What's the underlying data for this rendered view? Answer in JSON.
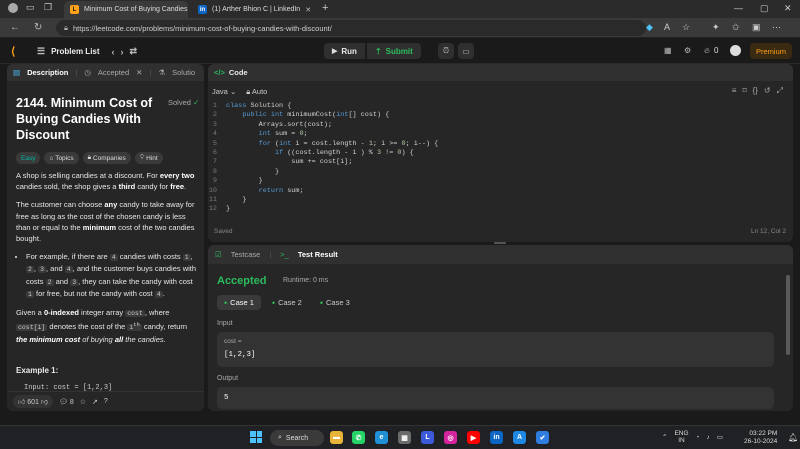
{
  "browser": {
    "tabs": [
      {
        "title": "Minimum Cost of Buying Candies",
        "icon": "leetcode-icon"
      },
      {
        "title": "(1) Arther Bhion C | LinkedIn",
        "icon": "linkedin-icon"
      }
    ],
    "url": "https://leetcode.com/problems/minimum-cost-of-buying-candies-with-discount/"
  },
  "header": {
    "problem_list": "Problem List",
    "run": "Run",
    "submit": "Submit",
    "streak": "0",
    "premium": "Premium"
  },
  "left": {
    "tabs": [
      "Description",
      "Accepted",
      "Solutio"
    ],
    "title": "2144. Minimum Cost of Buying Candies With Discount",
    "solved": "Solved",
    "chips": [
      "Easy",
      "Topics",
      "Companies",
      "Hint"
    ],
    "example_heading": "Example 1:",
    "example_line": "Input: cost = [1,2,3]",
    "likes": "601",
    "comments": "8"
  },
  "code": {
    "tab": "Code",
    "language": "Java",
    "mode": "Auto",
    "lines": [
      "class Solution {",
      "    public int minimumCost(int[] cost) {",
      "        Arrays.sort(cost);",
      "        int sum = 0;",
      "        for (int i = cost.length - 1; i >= 0; i--) {",
      "            if ((cost.length - i ) % 3 != 0) {",
      "                sum += cost[i];",
      "            }",
      "        }",
      "        return sum;",
      "    }",
      "}"
    ],
    "saved": "Saved",
    "cursor": "Ln 12, Col 2"
  },
  "result": {
    "tabs": [
      "Testcase",
      "Test Result"
    ],
    "status": "Accepted",
    "runtime": "Runtime: 0 ms",
    "cases": [
      "Case 1",
      "Case 2",
      "Case 3"
    ],
    "input_label": "Input",
    "input_name": "cost =",
    "input_value": "[1,2,3]",
    "output_label": "Output",
    "output_value": "5"
  },
  "taskbar": {
    "search": "Search",
    "lang": "ENG",
    "region": "IN",
    "time": "03:22 PM",
    "date": "26-10-2024"
  },
  "colors": {
    "accent": "#ffa116",
    "success": "#2cbb5d",
    "easy": "#00b8a3"
  }
}
